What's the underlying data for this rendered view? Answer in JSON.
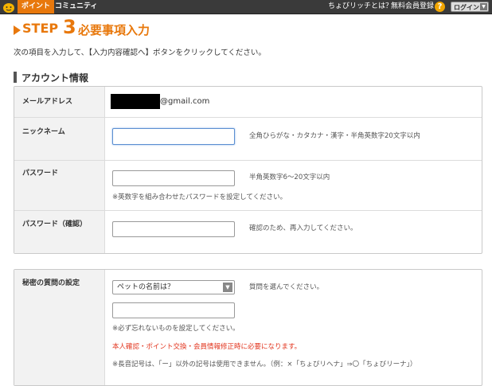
{
  "header": {
    "tabs": [
      {
        "label": "ポイント"
      },
      {
        "label": "コミュニティ"
      }
    ],
    "about_link": "ちょびリッチとは？",
    "register_link": "無料会員登録",
    "help_icon": "?",
    "login_label": "ログイン",
    "login_arrow": "▼"
  },
  "step": {
    "word": "STEP",
    "number": "3",
    "title": "必要事項入力"
  },
  "instruction": "次の項目を入力して、【入力内容確認へ】ボタンをクリックしてください。",
  "account": {
    "section_title": "アカウント情報",
    "email": {
      "label": "メールアドレス",
      "domain": "@gmail.com"
    },
    "nickname": {
      "label": "ニックネーム",
      "value": "",
      "hint": "全角ひらがな・カタカナ・漢字・半角英数字20文字以内"
    },
    "password": {
      "label": "パスワード",
      "value": "",
      "hint": "半角英数字6～20文字以内",
      "note": "※英数字を組み合わせたパスワードを設定してください。"
    },
    "password_confirm": {
      "label": "パスワード（確認）",
      "value": "",
      "hint": "確認のため、再入力してください。"
    }
  },
  "secret": {
    "label": "秘密の質問の設定",
    "selected": "ペットの名前は？",
    "select_hint": "質問を選んでください。",
    "answer_value": "",
    "note1": "※必ず忘れないものを設定してください。",
    "note_red": "本人確認・ポイント交換・会員情報修正時に必要になります。",
    "note2": "※長音記号は、「ー」以外の記号は使用できません。（例：×「ちょびリへナ」⇒〇「ちょびリーナ」）"
  },
  "colors": {
    "accent": "#e8780c",
    "warning": "#e2341d",
    "topbar": "#3a3a3a"
  }
}
